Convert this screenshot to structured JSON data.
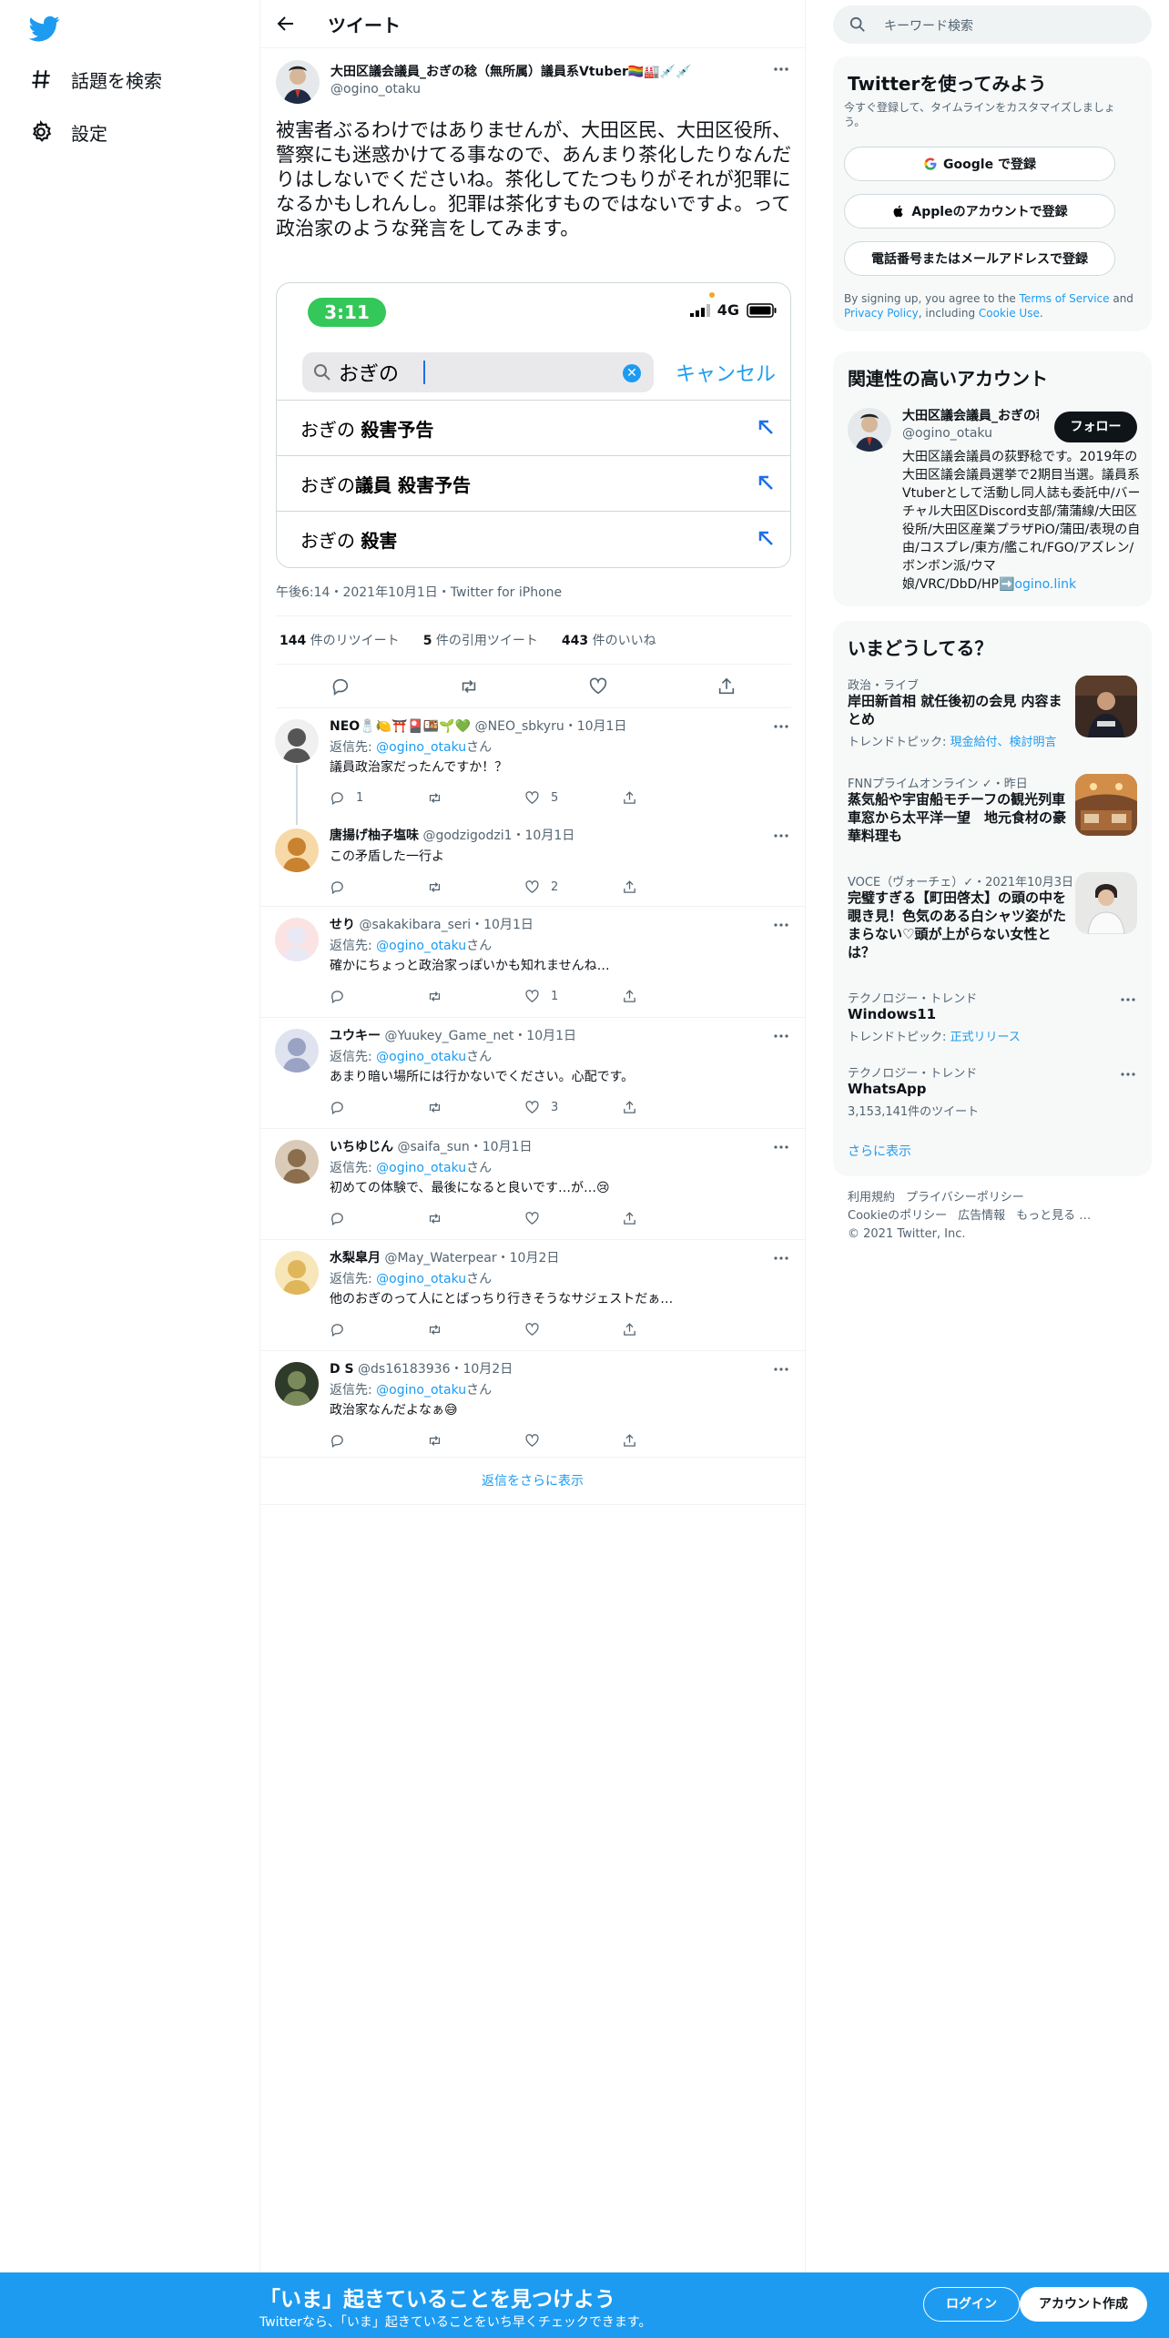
{
  "nav": {
    "logo_icon": "twitter-bird-icon",
    "explore_label": "話題を検索",
    "settings_label": "設定"
  },
  "header": {
    "title": "ツイート"
  },
  "tweet": {
    "author_name": "大田区議会議員_おぎの稔（無所属）議員系Vtuber🏳️‍🌈🏭💉💉",
    "author_handle": "@ogino_otaku",
    "text": "被害者ぶるわけではありませんが、大田区民、大田区役所、警察にも迷惑かけてる事なので、あんまり茶化したりなんだりはしないでくださいね。茶化してたつもりがそれが犯罪になるかもしれんし。犯罪は茶化すものではないですよ。って政治家のような発言をしてみます。",
    "embed": {
      "time": "3:11",
      "network": "4G",
      "query": "おぎの",
      "cancel": "キャンセル",
      "suggestions": [
        {
          "prefix": "おぎの ",
          "bold": "殺害予告"
        },
        {
          "prefix": "おぎの",
          "bold": "議員 殺害予告"
        },
        {
          "prefix": "おぎの ",
          "bold": "殺害"
        }
      ]
    },
    "meta": "午後6:14・2021年10月1日・Twitter for iPhone",
    "retweets": "144",
    "retweets_label": "件のリツイート",
    "quotes": "5",
    "quotes_label": "件の引用ツイート",
    "likes": "443",
    "likes_label": "件のいいね"
  },
  "replies": [
    {
      "name": "NEO🧂🍋⛩️🎴🍱🌱💚",
      "handle": "@NEO_sbkyru",
      "date": "・10月1日",
      "reply_to": "@ogino_otaku",
      "text": "議員政治家だったんですか！？",
      "replies": "1",
      "retweets": "",
      "likes": "5"
    },
    {
      "name": "唐揚げ柚子塩味",
      "handle": "@godzigodzi1",
      "date": "・10月1日",
      "reply_to": "",
      "text": "この矛盾した一行よ",
      "replies": "",
      "retweets": "",
      "likes": "2"
    },
    {
      "name": "せり",
      "handle": "@sakakibara_seri",
      "date": "・10月1日",
      "reply_to": "@ogino_otaku",
      "text": "確かにちょっと政治家っぽいかも知れませんね…",
      "replies": "",
      "retweets": "",
      "likes": "1"
    },
    {
      "name": "ユウキー",
      "handle": "@Yuukey_Game_net",
      "date": "・10月1日",
      "reply_to": "@ogino_otaku",
      "text": "あまり暗い場所には行かないでください。心配です。",
      "replies": "",
      "retweets": "",
      "likes": "3"
    },
    {
      "name": "いちゆじん",
      "handle": "@saifa_sun",
      "date": "・10月1日",
      "reply_to": "@ogino_otaku",
      "text": "初めての体験で、最後になると良いです…が…😢",
      "replies": "",
      "retweets": "",
      "likes": ""
    },
    {
      "name": "水梨皐月",
      "handle": "@May_Waterpear",
      "date": "・10月2日",
      "reply_to": "@ogino_otaku",
      "text": "他のおぎのって人にとばっちり行きそうなサジェストだぁ…",
      "replies": "",
      "retweets": "",
      "likes": ""
    },
    {
      "name": "D S",
      "handle": "@ds16183936",
      "date": "・10月2日",
      "reply_to": "@ogino_otaku",
      "text": "政治家なんだよなぁ😅",
      "replies": "",
      "retweets": "",
      "likes": ""
    }
  ],
  "reply_prefix": "返信先: ",
  "reply_suffix": "さん",
  "show_more_replies": "返信をさらに表示",
  "right": {
    "search_placeholder": "キーワード検索",
    "signup": {
      "title": "Twitterを使ってみよう",
      "subtitle": "今すぐ登録して、タイムラインをカスタマイズしましょう。",
      "google": "Google で登録",
      "apple": "Appleのアカウントで登録",
      "phone": "電話番号またはメールアドレスで登録",
      "terms_prefix": "By signing up, you agree to the ",
      "terms": "Terms of Service",
      "and": " and ",
      "privacy": "Privacy Policy",
      "including": ", including ",
      "cookie": "Cookie Use",
      "end": "."
    },
    "related": {
      "title": "関連性の高いアカウント",
      "name": "大田区議会議員_おぎの稔",
      "handle": "@ogino_otaku",
      "follow": "フォロー",
      "bio": "大田区議会議員の荻野稔です。2019年の大田区議会議員選挙で2期目当選。議員系Vtuberとして活動し同人誌も委託中/バーチャル大田区Discord支部/蒲蒲線/大田区役所/大田区産業プラザPiO/蒲田/表現の自由/コスプレ/東方/艦これ/FGO/アズレン/ボンボン派/ウマ娘/VRC/DbD/HP➡️",
      "bio_link": "ogino.link"
    },
    "trends": {
      "title": "いまどうしてる？",
      "items": [
        {
          "category": "政治・ライブ",
          "title": "岸田新首相 就任後初の会見 内容まとめ",
          "sub_prefix": "トレンドトピック: ",
          "sub_links": "現金給付、検討明言"
        },
        {
          "category": "FNNプライムオンライン ✓・昨日",
          "title": "蒸気船や宇宙船モチーフの観光列車　車窓から太平洋一望　地元食材の豪華料理も",
          "sub_prefix": "",
          "sub_links": ""
        },
        {
          "category": "VOCE（ヴォーチェ）✓・2021年10月3日",
          "title": "完璧すぎる【町田啓太】の頭の中を覗き見！色気のある白シャツ姿がたまらない♡頭が上がらない女性とは？",
          "sub_prefix": "",
          "sub_links": ""
        },
        {
          "category": "テクノロジー・トレンド",
          "title": "Windows11",
          "sub_prefix": "トレンドトピック: ",
          "sub_links": "正式リリース"
        },
        {
          "category": "テクノロジー・トレンド",
          "title": "WhatsApp",
          "sub_prefix": "3,153,141件のツイート",
          "sub_links": ""
        }
      ],
      "more": "さらに表示"
    },
    "footer": {
      "links1": [
        "利用規約",
        "プライバシーポリシー"
      ],
      "links2": [
        "Cookieのポリシー",
        "広告情報",
        "もっと見る …"
      ],
      "copyright": "© 2021 Twitter, Inc."
    }
  },
  "banner": {
    "title": "「いま」起きていることを見つけよう",
    "subtitle": "Twitterなら、「いま」起きていることをいち早くチェックできます。",
    "login": "ログイン",
    "signup": "アカウント作成"
  },
  "colors": {
    "accent": "#1d9bf0",
    "text": "#0f1419",
    "secondary": "#536471"
  }
}
